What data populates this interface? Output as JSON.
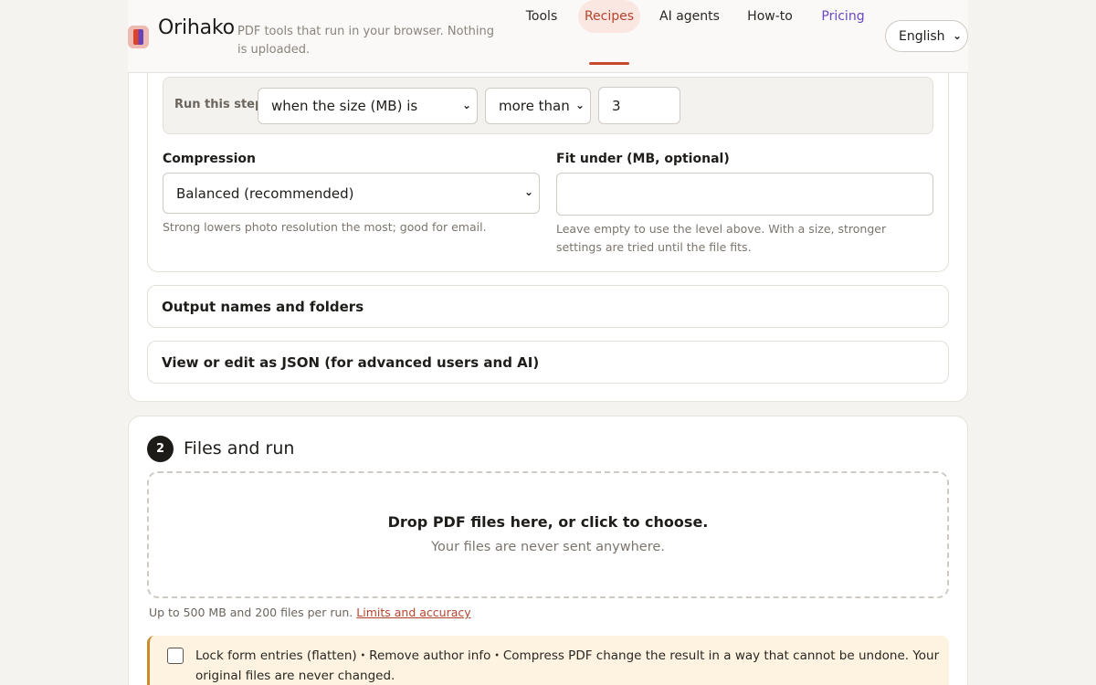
{
  "header": {
    "brand": "Orihako",
    "tagline": "PDF tools that run in your browser. Nothing is uploaded.",
    "nav": [
      {
        "label": "Tools"
      },
      {
        "label": "Recipes",
        "active": true
      },
      {
        "label": "AI agents"
      },
      {
        "label": "How-to"
      },
      {
        "label": "Pricing"
      }
    ],
    "language": "English"
  },
  "step": {
    "condition": {
      "label": "Run this step",
      "field": "when the size (MB) is",
      "operator": "more than",
      "value": "3"
    },
    "compression": {
      "label": "Compression",
      "value": "Balanced (recommended)",
      "help": "Strong lowers photo resolution the most; good for email."
    },
    "fit_under": {
      "label": "Fit under (MB, optional)",
      "value": "",
      "help": "Leave empty to use the level above. With a size, stronger settings are tried until the file fits."
    }
  },
  "sections": {
    "output_names": "Output names and folders",
    "json_edit": "View or edit as JSON (for advanced users and AI)"
  },
  "files": {
    "step_number": "2",
    "title": "Files and run",
    "drop_title": "Drop PDF files here, or click to choose.",
    "drop_sub": "Your files are never sent anywhere.",
    "limits_text": "Up to 500 MB and 200 files per run.",
    "limits_link": "Limits and accuracy",
    "warning": "Lock form entries (flatten)・Remove author info・Compress PDF change the result in a way that cannot be undone. Your original files are never changed."
  },
  "colors": {
    "accent": "#c4492f",
    "pricing": "#6a46c2",
    "warning_bg": "#fdf3e0",
    "warning_border": "#c98a2a"
  }
}
